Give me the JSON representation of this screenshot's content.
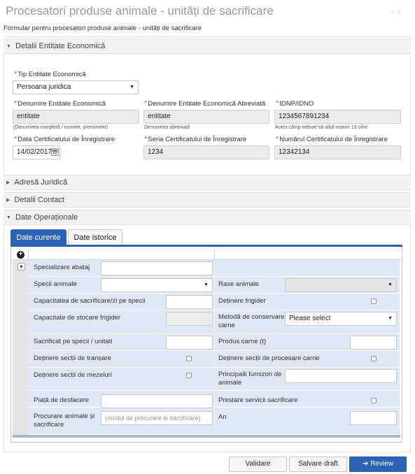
{
  "page": {
    "title": "Procesatori produse animale - unități de sacrificare",
    "subtitle": "Formular pentru procesatori produse animale - unități de sacrificare"
  },
  "sections": {
    "entitate": "Detalii Entitate Economică",
    "adresa": "Adresă Juridică",
    "contact": "Detalii Contact",
    "operationale": "Date Operaționale"
  },
  "entity": {
    "tip_label": "Tip Entitate Economică",
    "tip_value": "Persoana juridica",
    "denumire_label": "Denumire Entitate Economică",
    "denumire_value": "entitate",
    "denumire_hint": "(Denumirea completă / numele, prenumele)",
    "abrev_label": "Denumire Entitate Economică Abreviată",
    "abrev_value": "entitate",
    "abrev_hint": "Denumirea abreviată",
    "idno_label": "IDNP/IDNO",
    "idno_value": "1234567891234",
    "idno_hint": "Acest câmp trebuie să aibă maxim 13 cifre",
    "data_label": "Data Certificatului de Înregistrare",
    "data_value": "14/02/2017",
    "seria_label": "Seria Certificatului de Înregistrare",
    "seria_value": "1234",
    "numar_label": "Numărul Certificatului de Înregistrare",
    "numar_value": "12342134"
  },
  "tabs": {
    "current": "Date curente",
    "history": "Date istorice"
  },
  "grid": {
    "add_icon": "plus-circle-icon",
    "specializare": "Specializare abataj",
    "specii": "Specii animale",
    "rase": "Rase animale",
    "capacitate_sacrificare": "Capacitatea de sacrificare/zi pe specii",
    "detinere_frigider": "Deținere frigider",
    "capacitate_stocare": "Capacitate de stocare frigider",
    "metoda_conservare": "Metodă de conservare carne",
    "metoda_placeholder": "Please select",
    "sacrificat": "Sacrificat pe specii / unitati",
    "produs_carne": "Produs carne (t)",
    "sectii_transare": "Deținere secții de tranșare",
    "sectii_procesare": "Deținere secții de procesare carne",
    "sectii_mezeluri": "Deținere secții de mezeluri",
    "furnizori": "Principalii furnizori de animale",
    "piata": "Piață de desfacere",
    "prestare": "Prestare servicii sacrificare",
    "procurare": "Procurare animale și sacrificare",
    "procurare_placeholder": "(modul de procurare și sacrificare)",
    "an": "An"
  },
  "buttons": {
    "validate": "Validare",
    "draft": "Salvare draft",
    "review": "Review"
  },
  "colors": {
    "accent": "#2c63b7",
    "grid_bg": "#dfe8f6"
  }
}
